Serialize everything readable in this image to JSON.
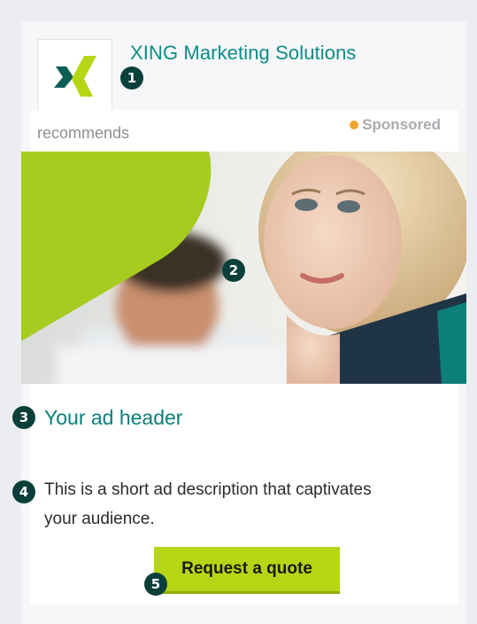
{
  "company": {
    "name": "XING Marketing Solutions",
    "logo_icon": "xing-logo-icon"
  },
  "recommends_label": "recommends",
  "sponsored_label": "Sponsored",
  "ad": {
    "header": "Your ad header",
    "description": "This is a short ad description that captivates your audience.",
    "cta_label": "Request a quote"
  },
  "markers": [
    "1",
    "2",
    "3",
    "4",
    "5"
  ],
  "colors": {
    "brand_teal": "#0a8e86",
    "cta_green": "#b5d614",
    "marker_bg": "#0b3f3c",
    "sponsored_dot": "#f4a52c"
  }
}
